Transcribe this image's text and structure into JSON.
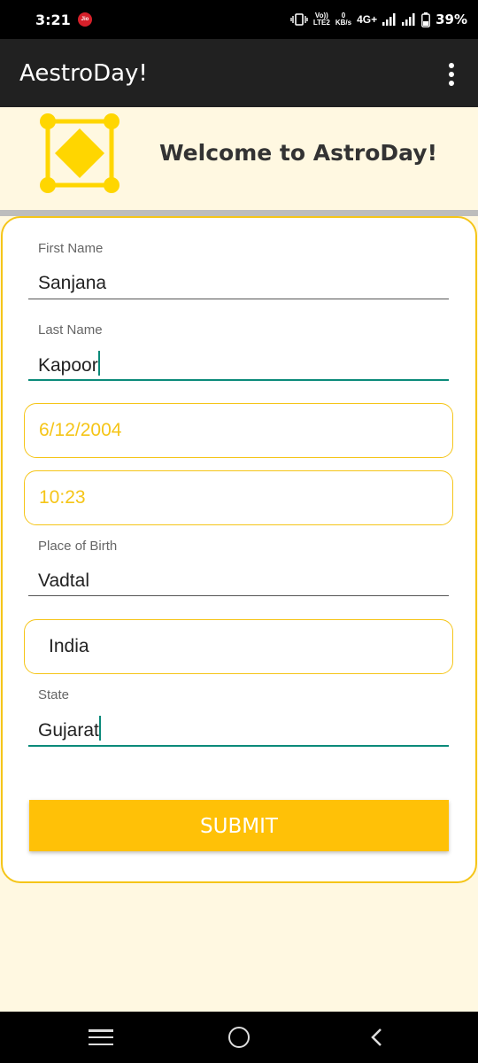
{
  "status_bar": {
    "time": "3:21",
    "carrier_badge": "Jio",
    "volte_top": "Vo))",
    "volte_bottom": "LTE2",
    "speed_value": "0",
    "speed_unit": "KB/s",
    "network": "4G+",
    "battery": "39%"
  },
  "app_bar": {
    "title": "AestroDay!"
  },
  "header": {
    "welcome": "Welcome to AstroDay!"
  },
  "form": {
    "first_name": {
      "label": "First Name",
      "value": "Sanjana"
    },
    "last_name": {
      "label": "Last Name",
      "value": "Kapoor"
    },
    "date_of_birth": {
      "value": "6/12/2004"
    },
    "time_of_birth": {
      "value": "10:23"
    },
    "place_of_birth": {
      "label": "Place of Birth",
      "value": "Vadtal"
    },
    "country": {
      "value": "India"
    },
    "state": {
      "label": "State",
      "value": "Gujarat"
    },
    "submit_label": "SUBMIT"
  },
  "colors": {
    "accent": "#FFC107",
    "outline": "#F5C518",
    "focus": "#0B8A7A",
    "app_bar": "#212121",
    "background": "#FFF8E1"
  },
  "icons": {
    "status_vibrate": "vibrate-icon",
    "status_signal": "signal-icon",
    "status_battery": "battery-icon",
    "overflow": "more-vert-icon",
    "logo": "astro-diamond-logo",
    "nav_recents": "menu-icon",
    "nav_home": "circle-home-icon",
    "nav_back": "chevron-left-icon"
  }
}
